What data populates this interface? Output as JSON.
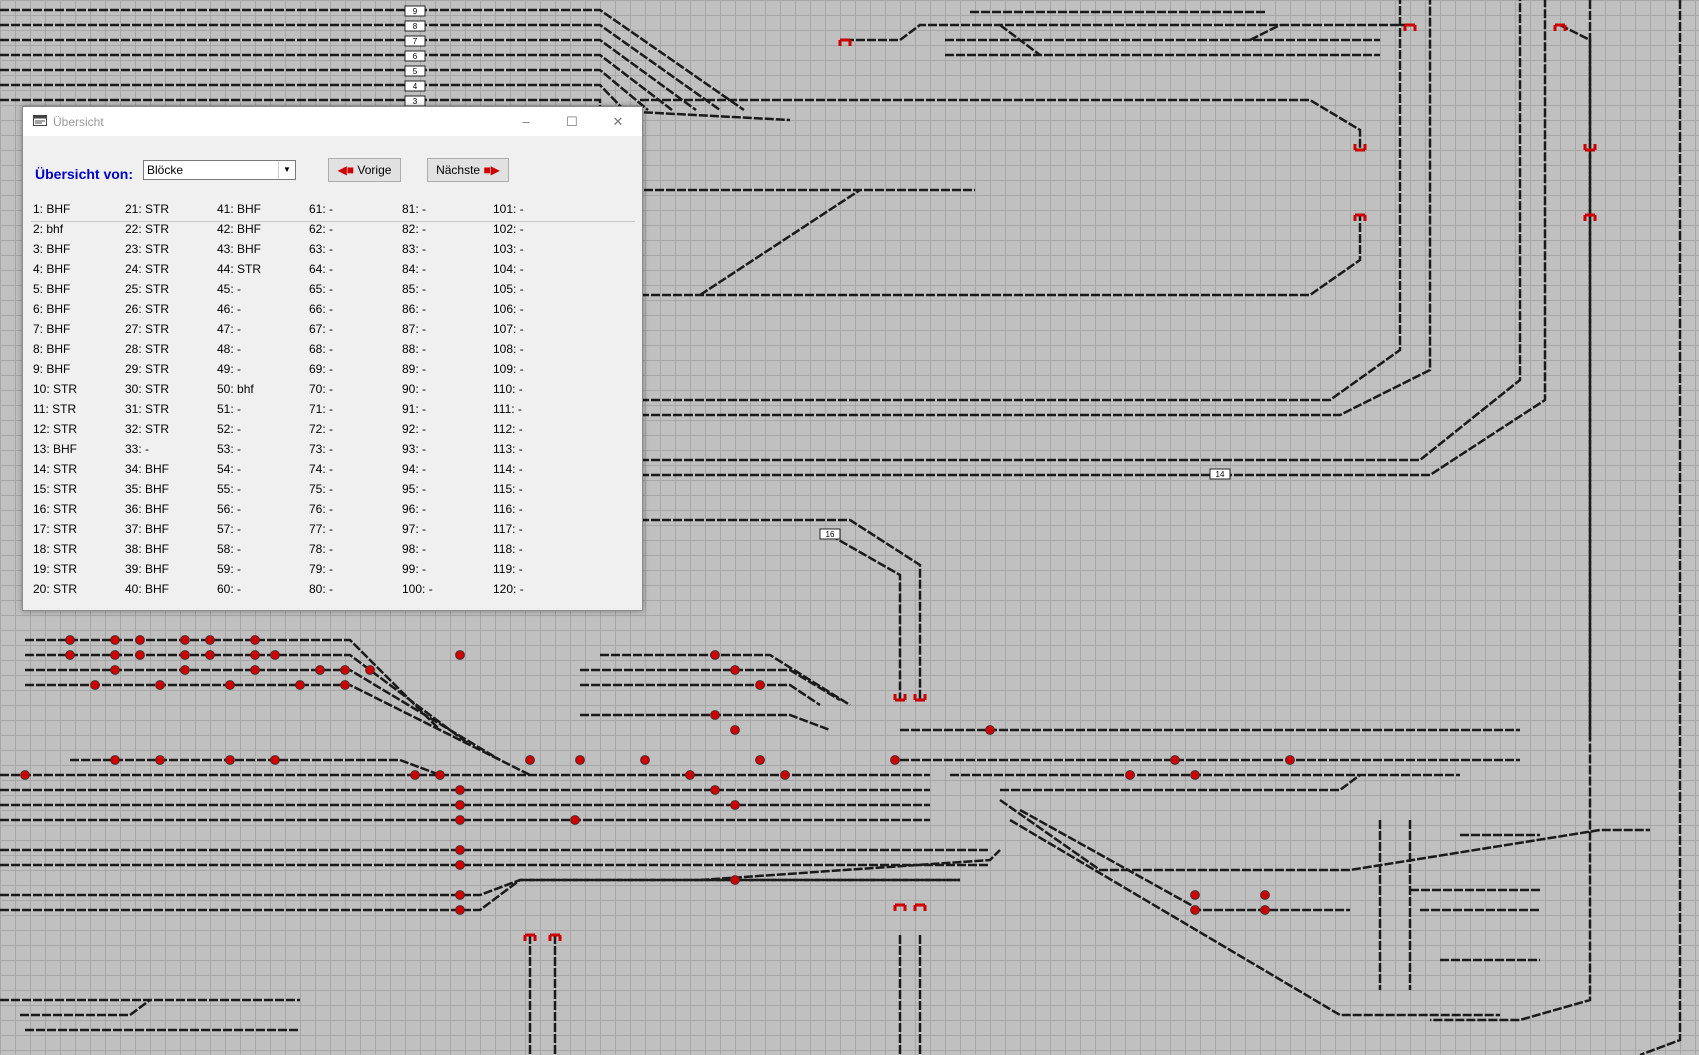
{
  "colors": {
    "background": "#c0c0c0",
    "track": "#1a1a1a",
    "signal": "#cc0000",
    "buffer_stop": "#cc0000",
    "dialog_bg": "#f0f0f0",
    "label_blue": "#0000cc"
  },
  "track_labels": {
    "track_numbers": [
      "9",
      "8",
      "7",
      "6",
      "5",
      "4",
      "3"
    ],
    "block_14": "14",
    "block_16": "16"
  },
  "dialog": {
    "title": "Übersicht",
    "icon": "app-window-icon",
    "overview_label": "Übersicht von:",
    "select_value": "Blöcke",
    "prev_label": "Vorige",
    "next_label": "Nächste",
    "prev_icon": "arrow-left-icon",
    "next_icon": "arrow-right-icon",
    "columns": [
      [
        "1: BHF",
        "2: bhf",
        "3: BHF",
        "4: BHF",
        "5: BHF",
        "6: BHF",
        "7: BHF",
        "8: BHF",
        "9: BHF",
        "10: STR",
        "11: STR",
        "12: STR",
        "13: BHF",
        "14: STR",
        "15: STR",
        "16: STR",
        "17: STR",
        "18: STR",
        "19: STR",
        "20: STR"
      ],
      [
        "21: STR",
        "22: STR",
        "23: STR",
        "24: STR",
        "25: STR",
        "26: STR",
        "27: STR",
        "28: STR",
        "29: STR",
        "30: STR",
        "31: STR",
        "32: STR",
        "33: -",
        "34: BHF",
        "35: BHF",
        "36: BHF",
        "37: BHF",
        "38: BHF",
        "39: BHF",
        "40: BHF"
      ],
      [
        "41: BHF",
        "42: BHF",
        "43: BHF",
        "44: STR",
        "45: -",
        "46: -",
        "47: -",
        "48: -",
        "49: -",
        "50: bhf",
        "51: -",
        "52: -",
        "53: -",
        "54: -",
        "55: -",
        "56: -",
        "57: -",
        "58: -",
        "59: -",
        "60: -"
      ],
      [
        "61: -",
        "62: -",
        "63: -",
        "64: -",
        "65: -",
        "66: -",
        "67: -",
        "68: -",
        "69: -",
        "70: -",
        "71: -",
        "72: -",
        "73: -",
        "74: -",
        "75: -",
        "76: -",
        "77: -",
        "78: -",
        "79: -",
        "80: -"
      ],
      [
        "81: -",
        "82: -",
        "83: -",
        "84: -",
        "85: -",
        "86: -",
        "87: -",
        "88: -",
        "89: -",
        "90: -",
        "91: -",
        "92: -",
        "93: -",
        "94: -",
        "95: -",
        "96: -",
        "97: -",
        "98: -",
        "99: -",
        "100: -"
      ],
      [
        "101: -",
        "102: -",
        "103: -",
        "104: -",
        "105: -",
        "106: -",
        "107: -",
        "108: -",
        "109: -",
        "110: -",
        "111: -",
        "112: -",
        "113: -",
        "114: -",
        "115: -",
        "116: -",
        "117: -",
        "118: -",
        "119: -",
        "120: -"
      ]
    ]
  }
}
